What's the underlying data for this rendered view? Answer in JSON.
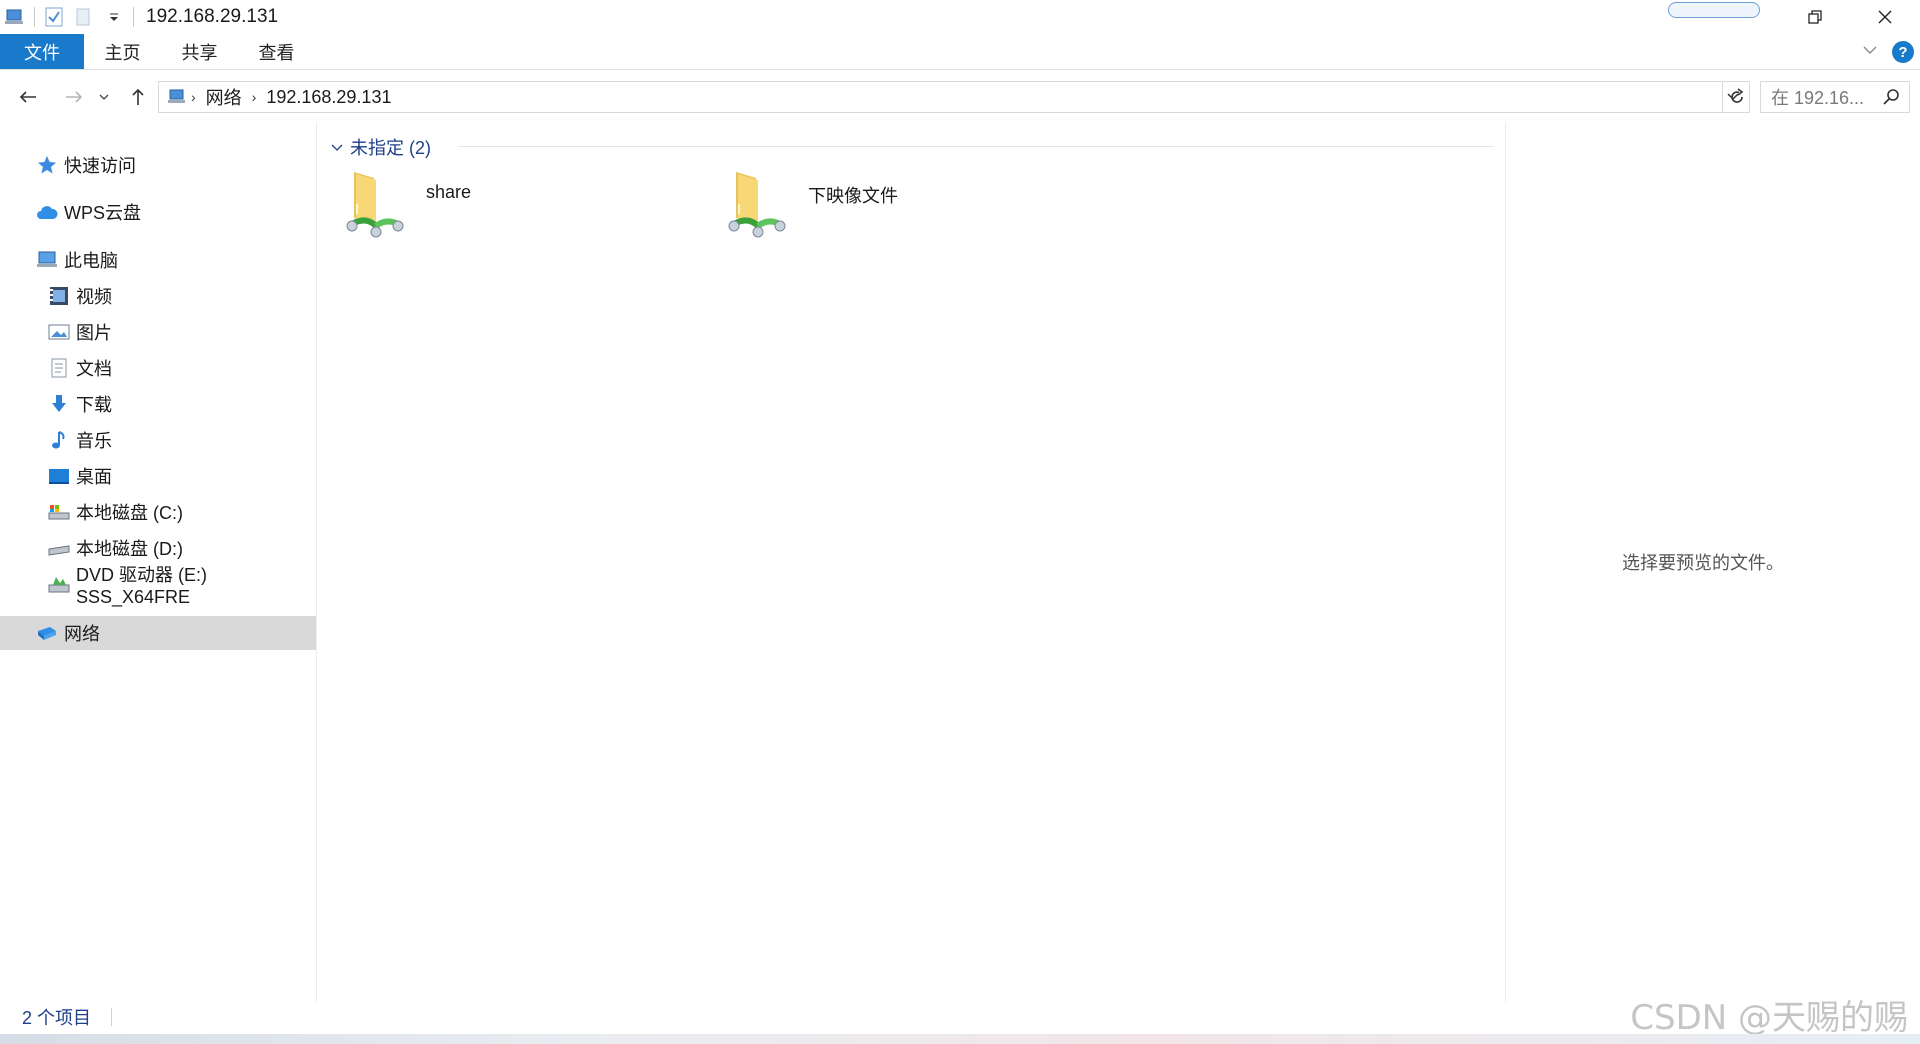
{
  "window": {
    "title": "192.168.29.131",
    "controls": [
      "restore-icon",
      "close-icon"
    ]
  },
  "ribbon": {
    "tabs": [
      {
        "label": "文件",
        "active": true
      },
      {
        "label": "主页"
      },
      {
        "label": "共享"
      },
      {
        "label": "查看"
      }
    ]
  },
  "address": {
    "breadcrumbs": [
      "网络",
      "192.168.29.131"
    ],
    "search_placeholder": "在 192.16..."
  },
  "navigation": {
    "items": [
      {
        "label": "快速访问",
        "icon": "star-icon"
      },
      {
        "label": "WPS云盘",
        "icon": "cloud-icon"
      },
      {
        "label": "此电脑",
        "icon": "computer-icon"
      },
      {
        "label": "视频",
        "icon": "video-icon"
      },
      {
        "label": "图片",
        "icon": "picture-icon"
      },
      {
        "label": "文档",
        "icon": "document-icon"
      },
      {
        "label": "下载",
        "icon": "download-icon"
      },
      {
        "label": "音乐",
        "icon": "music-icon"
      },
      {
        "label": "桌面",
        "icon": "desktop-icon"
      },
      {
        "label": "本地磁盘 (C:)",
        "icon": "drive-c-icon"
      },
      {
        "label": "本地磁盘 (D:)",
        "icon": "drive-d-icon"
      },
      {
        "label": "DVD 驱动器 (E:) SSS_X64FRE",
        "icon": "dvd-icon"
      },
      {
        "label": "网络",
        "icon": "network-icon",
        "selected": true
      }
    ]
  },
  "content": {
    "group_header": "未指定 (2)",
    "items": [
      {
        "name": "share",
        "icon": "network-share-folder-icon"
      },
      {
        "name": "下映像文件",
        "icon": "network-share-folder-icon"
      }
    ]
  },
  "preview": {
    "message": "选择要预览的文件。"
  },
  "status": {
    "item_count": "2 个项目"
  },
  "watermark": "CSDN @天赐的赐",
  "colors": {
    "accent": "#1979ca",
    "selected_bg": "#d9d9d9",
    "link_text": "#1e3f8a"
  }
}
